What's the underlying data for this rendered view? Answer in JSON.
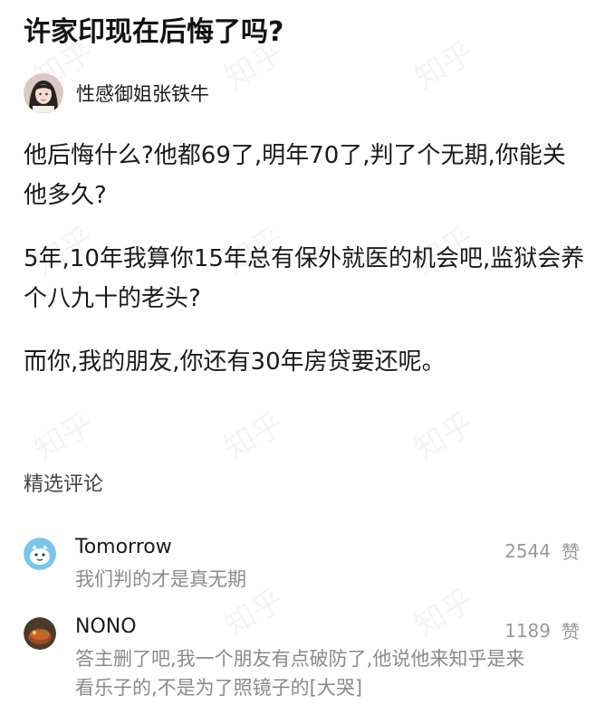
{
  "question": {
    "title": "许家印现在后悔了吗?"
  },
  "author": {
    "name": "性感御姐张铁牛"
  },
  "answer": {
    "paragraphs": [
      "他后悔什么?他都69了,明年70了,判了个无期,你能关他多久?",
      "5年,10年我算你15年总有保外就医的机会吧,监狱会养个八九十的老头?",
      "而你,我的朋友,你还有30年房贷要还呢。"
    ]
  },
  "comments_section": {
    "heading": "精选评论",
    "like_label": "赞",
    "items": [
      {
        "author": "Tomorrow",
        "text": "我们判的才是真无期",
        "likes": "2544"
      },
      {
        "author": "NONO",
        "text": "答主删了吧,我一个朋友有点破防了,他说他来知乎是来看乐子的,不是为了照镜子的[大哭]",
        "likes": "1189"
      }
    ]
  },
  "watermark": {
    "text": "知乎"
  },
  "colors": {
    "title": "#121212",
    "body_text": "#1a1a1a",
    "comment_text": "#8a8a8a",
    "likes_text": "#999999"
  }
}
